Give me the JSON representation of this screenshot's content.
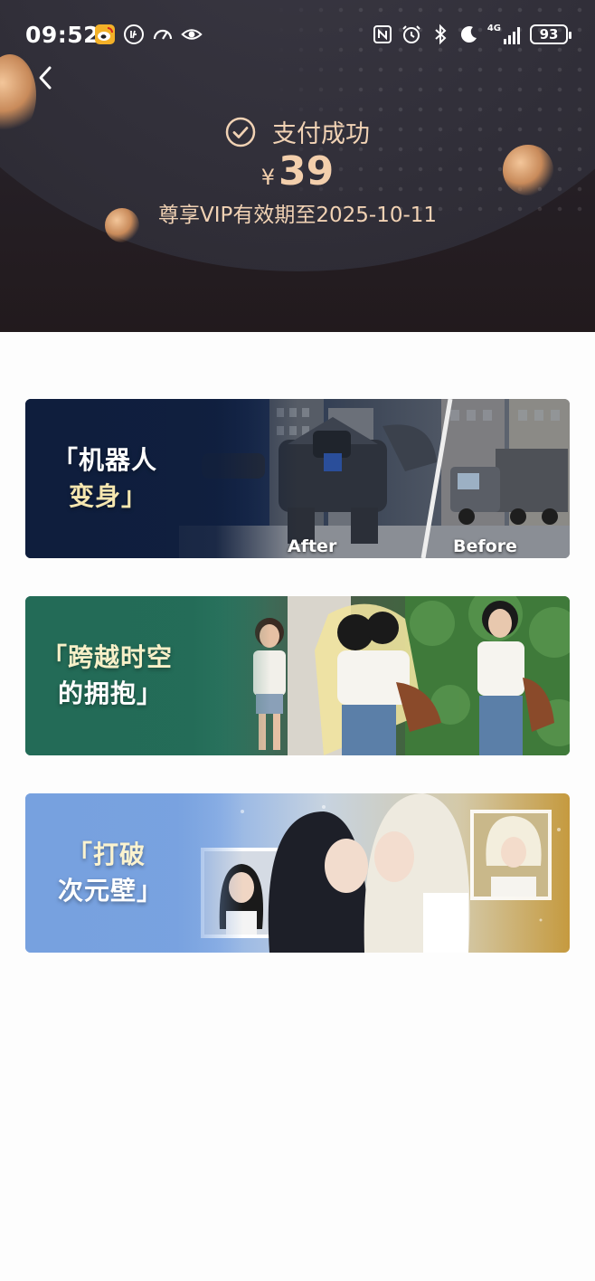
{
  "status_bar": {
    "time": "09:52",
    "battery": "93",
    "network": "4G",
    "left_icons": [
      "weibo-icon",
      "app-badge-icon",
      "speedometer-icon",
      "eye-icon"
    ],
    "right_icons": [
      "nfc-icon",
      "alarm-icon",
      "bluetooth-icon",
      "moon-icon",
      "signal-icon",
      "battery-icon"
    ]
  },
  "header": {
    "status_text": "支付成功",
    "currency": "¥",
    "amount": "39",
    "vip_text": "尊享VIP有效期至2025-10-11"
  },
  "banners": [
    {
      "title_line1": "「机器人",
      "title_line2": "变身」",
      "label_after": "After",
      "label_before": "Before"
    },
    {
      "title_line1": "「跨越时空",
      "title_line2": "的拥抱」"
    },
    {
      "title_line1": "「打破",
      "title_line2": "次元壁」"
    }
  ],
  "colors": {
    "header_bg": "#2c2a33",
    "accent_gold": "#f1d2b4",
    "banner1_bg": "#16284a",
    "banner2_bg": "#2e7560",
    "banner3_bg": "#7ba4df"
  }
}
